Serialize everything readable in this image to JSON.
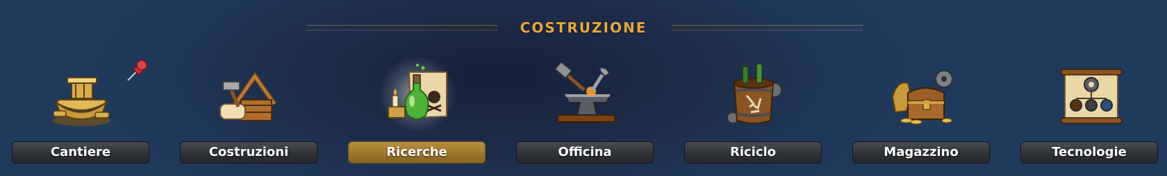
{
  "header": {
    "title": "COSTRUZIONE"
  },
  "accent_color": "#e7a93a",
  "selected_color": "#a07a2e",
  "items": [
    {
      "label": "Cantiere",
      "icon": "shipyard-icon",
      "selected": false,
      "pinned": true
    },
    {
      "label": "Costruzioni",
      "icon": "construction-icon",
      "selected": false
    },
    {
      "label": "Ricerche",
      "icon": "research-potion-icon",
      "selected": true
    },
    {
      "label": "Officina",
      "icon": "anvil-workshop-icon",
      "selected": false
    },
    {
      "label": "Riciclo",
      "icon": "recycle-barrel-icon",
      "selected": false
    },
    {
      "label": "Magazzino",
      "icon": "treasure-chest-icon",
      "selected": false
    },
    {
      "label": "Tecnologie",
      "icon": "tech-scroll-icon",
      "selected": false
    }
  ]
}
